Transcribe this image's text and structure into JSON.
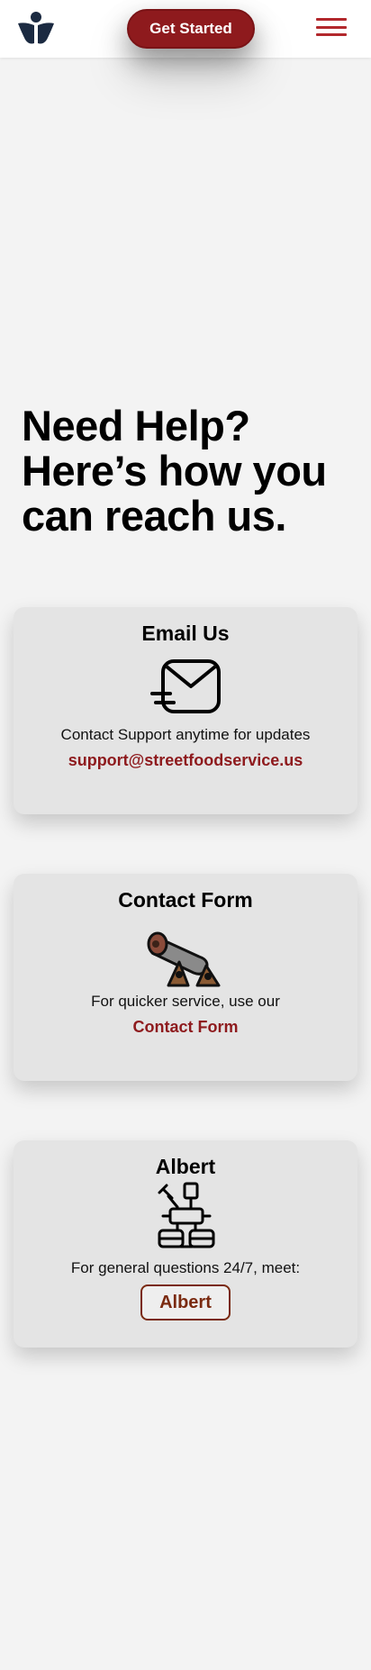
{
  "header": {
    "logo_icon": "person-figure-logo-icon",
    "cta_label": "Get Started",
    "menu_icon": "hamburger-menu-icon",
    "accent": "#8e1a1d",
    "menu_color": "#b2282c"
  },
  "hero": {
    "title": "Need Help? Here’s how you can reach us."
  },
  "cards": [
    {
      "title": "Email Us",
      "icon": "envelope-icon",
      "text": "Contact Support anytime for updates",
      "link": "support@streetfoodservice.us"
    },
    {
      "title": "Contact Form",
      "icon": "cannon-icon",
      "text": "For quicker service, use our",
      "link": "Contact Form"
    },
    {
      "title": "Albert",
      "icon": "robot-icon",
      "text": "For general questions 24/7, meet:",
      "button": "Albert"
    }
  ]
}
